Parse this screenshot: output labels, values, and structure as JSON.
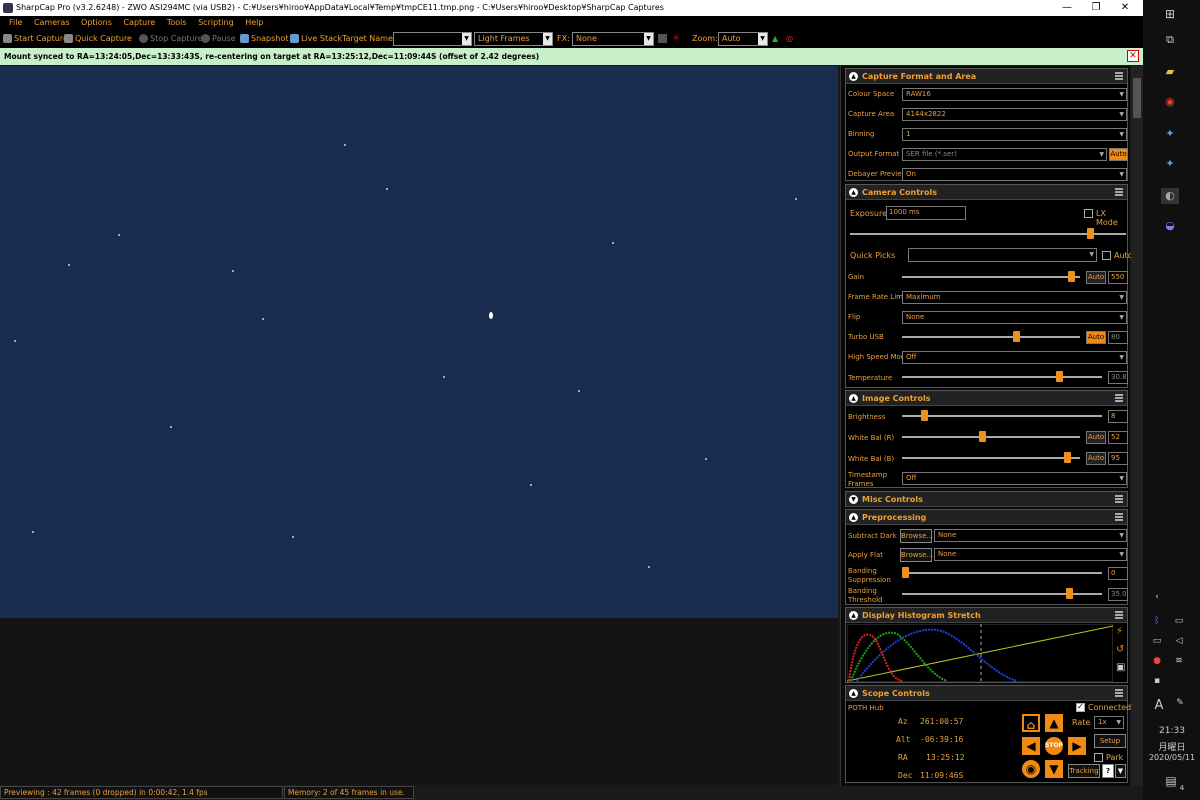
{
  "window": {
    "title": "SharpCap Pro (v3.2.6248) - ZWO ASI294MC (via USB2) - C:¥Users¥hiroo¥AppData¥Local¥Temp¥tmpCE11.tmp.png - C:¥Users¥hiroo¥Desktop¥SharpCap Captures",
    "min": "—",
    "max": "❐",
    "close": "✕"
  },
  "menu": [
    "File",
    "Cameras",
    "Options",
    "Capture",
    "Tools",
    "Scripting",
    "Help"
  ],
  "toolbar": {
    "start_capture": "Start Capture",
    "quick_capture": "Quick Capture",
    "stop_capture": "Stop Capture",
    "pause": "Pause",
    "snapshot": "Snapshot",
    "live_stack": "Live Stack",
    "target_name_label": "Target Name :",
    "target_name_value": "",
    "frame_type": "Light Frames",
    "fx_label": "FX:",
    "fx_value": "None",
    "zoom_label": "Zoom:",
    "zoom_value": "Auto"
  },
  "notification": "Mount synced to RA=13:24:05,Dec=13:33:43S, re-centering on target at RA=13:25:12,Dec=11:09:44S (offset of 2.42 degrees)",
  "capture_format": {
    "title": "Capture Format and Area",
    "colour_space_label": "Colour Space",
    "colour_space": "RAW16",
    "capture_area_label": "Capture Area",
    "capture_area": "4144x2822",
    "binning_label": "Binning",
    "binning": "1",
    "output_format_label": "Output Format",
    "output_format": "SER file (*.ser)",
    "output_auto": "Auto",
    "debayer_label": "Debayer Preview",
    "debayer": "On"
  },
  "camera_controls": {
    "title": "Camera Controls",
    "exposure_label": "Exposure",
    "exposure": "1000 ms",
    "lx_mode": "LX Mode",
    "exposure_level": 0.88,
    "quick_picks_label": "Quick Picks",
    "quick_picks_auto": "Auto",
    "gain_label": "Gain",
    "gain_auto": "Auto",
    "gain": "550",
    "gain_level": 0.97,
    "frame_rate_label": "Frame Rate Limit",
    "frame_rate": "Maximum",
    "flip_label": "Flip",
    "flip": "None",
    "turbo_label": "Turbo USB",
    "turbo_auto": "Auto",
    "turbo": "80",
    "turbo_level": 0.65,
    "high_speed_label": "High Speed Mode",
    "high_speed": "Off",
    "temperature_label": "Temperature",
    "temperature": "30.8",
    "temperature_level": 0.8
  },
  "image_controls": {
    "title": "Image Controls",
    "brightness_label": "Brightness",
    "brightness": "8",
    "brightness_level": 0.1,
    "wb_r_label": "White Bal (R)",
    "wb_r_auto": "Auto",
    "wb_r": "52",
    "wb_r_level": 0.45,
    "wb_b_label": "White Bal (B)",
    "wb_b_auto": "Auto",
    "wb_b": "95",
    "wb_b_level": 0.95,
    "timestamp_label": "Timestamp Frames",
    "timestamp": "Off"
  },
  "misc_controls": {
    "title": "Misc Controls"
  },
  "preprocessing": {
    "title": "Preprocessing",
    "subtract_dark_label": "Subtract Dark",
    "browse": "Browse...",
    "subtract_dark": "None",
    "apply_flat_label": "Apply Flat",
    "apply_flat": "None",
    "banding_suppression_label": "Banding Suppression",
    "banding_suppression": "0",
    "banding_suppression_level": 0.0,
    "banding_threshold_label": "Banding Threshold",
    "banding_threshold": "35.0",
    "banding_threshold_level": 0.85
  },
  "histogram": {
    "title": "Display Histogram Stretch"
  },
  "scope": {
    "title": "Scope Controls",
    "device": "POTH Hub",
    "connected": "Connected",
    "az_label": "Az",
    "az": "261:00:57",
    "alt_label": "Alt",
    "alt": "-06:39:16",
    "ra_label": "RA",
    "ra": "13:25:12",
    "dec_label": "Dec",
    "dec": "11:09:46S",
    "rate_label": "Rate",
    "rate": "1x",
    "setup": "Setup",
    "park": "Park",
    "tracking": "Tracking",
    "stop": "STOP",
    "help": "?"
  },
  "status": {
    "preview": "Previewing : 42 frames (0 dropped) in 0:00:42, 1.4 fps",
    "memory": "Memory: 2 of 45 frames in use."
  },
  "taskbar": {
    "time": "21:33",
    "weekday": "月曜日",
    "date": "2020/05/11",
    "ime": "A",
    "notif_count": "4"
  },
  "colors": {
    "accent": "#f0a030",
    "image_bg": "#1b2d4f",
    "notify_bg": "#c8f0c8"
  }
}
